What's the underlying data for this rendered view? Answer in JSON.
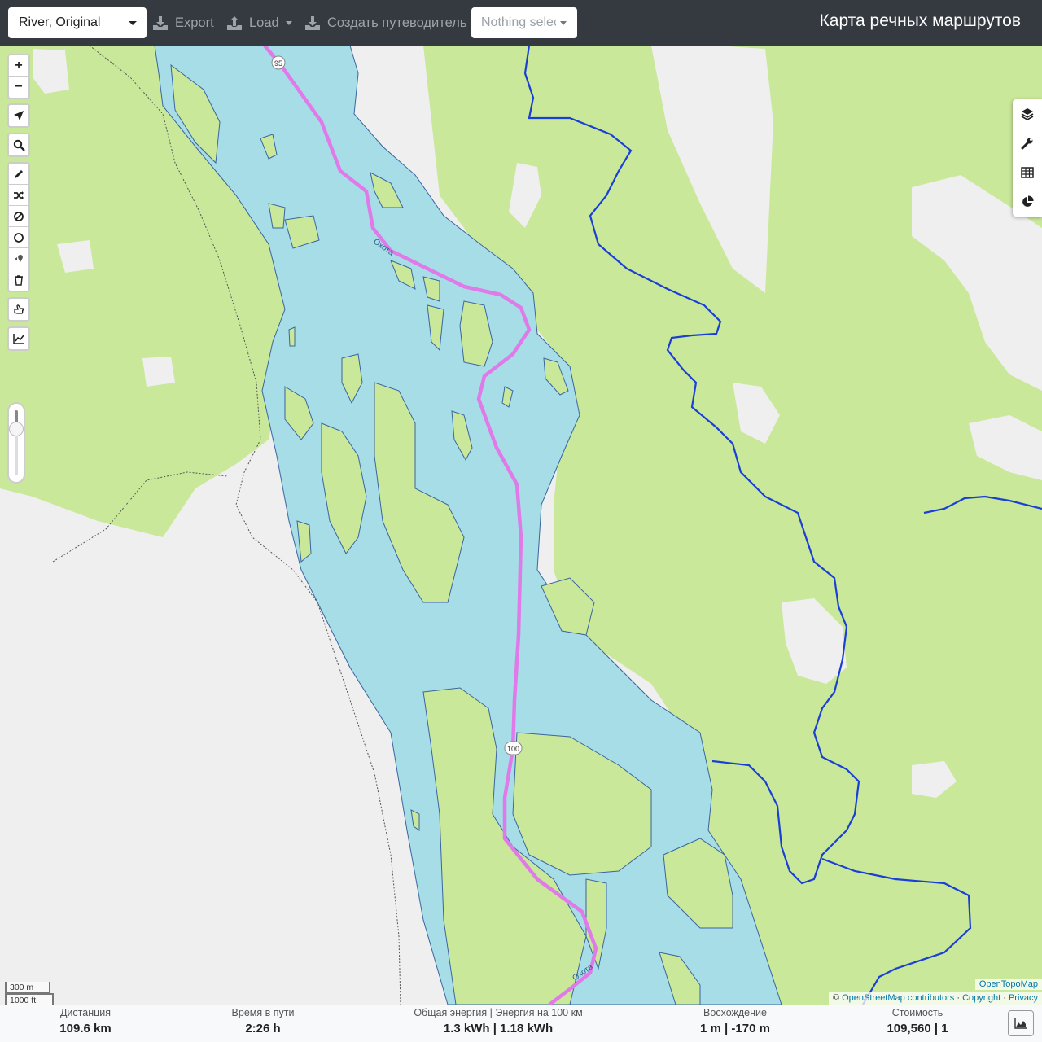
{
  "topbar": {
    "profile": "River, Original",
    "export_label": "Export",
    "load_label": "Load",
    "guide_label": "Создать путеводитель",
    "route_select": "Nothing selected",
    "app_title": "Карта речных маршрутов"
  },
  "map": {
    "river_name": "Охота",
    "marker_95": "95",
    "marker_100": "100",
    "colors": {
      "water": "#a6dde6",
      "forest": "#c9e89a",
      "land": "#efefef",
      "route": "#e07ae8",
      "stream": "#1a3fd6"
    }
  },
  "controls": {
    "left": [
      "zoom-in",
      "zoom-out",
      "locate",
      "search",
      "draw",
      "reverse",
      "delete-point",
      "circle",
      "poi",
      "trash",
      "no-go",
      "elevation"
    ],
    "zoom_in": "+",
    "zoom_out": "−",
    "right": [
      "layers-icon",
      "wrench-icon",
      "table-icon",
      "pie-chart-icon"
    ]
  },
  "scale": {
    "metric": "300 m",
    "imperial": "1000 ft"
  },
  "attribution": {
    "layer": "OpenTopoMap",
    "copyright_symbol": "©",
    "osm": "OpenStreetMap contributors",
    "sep1": " · ",
    "copyright": "Copyright",
    "sep2": " · ",
    "privacy": "Privacy"
  },
  "stats": {
    "distance": {
      "label": "Дистанция",
      "value": "109.6 km"
    },
    "time": {
      "label": "Время в пути",
      "value": "2:26 h"
    },
    "energy": {
      "label": "Общая энергия | Энергия на 100 км",
      "value": "1.3 kWh | 1.18 kWh"
    },
    "ascent": {
      "label": "Восхождение",
      "value": "1 m | -170 m"
    },
    "cost": {
      "label": "Стоимость",
      "value": "109,560 | 1"
    }
  }
}
